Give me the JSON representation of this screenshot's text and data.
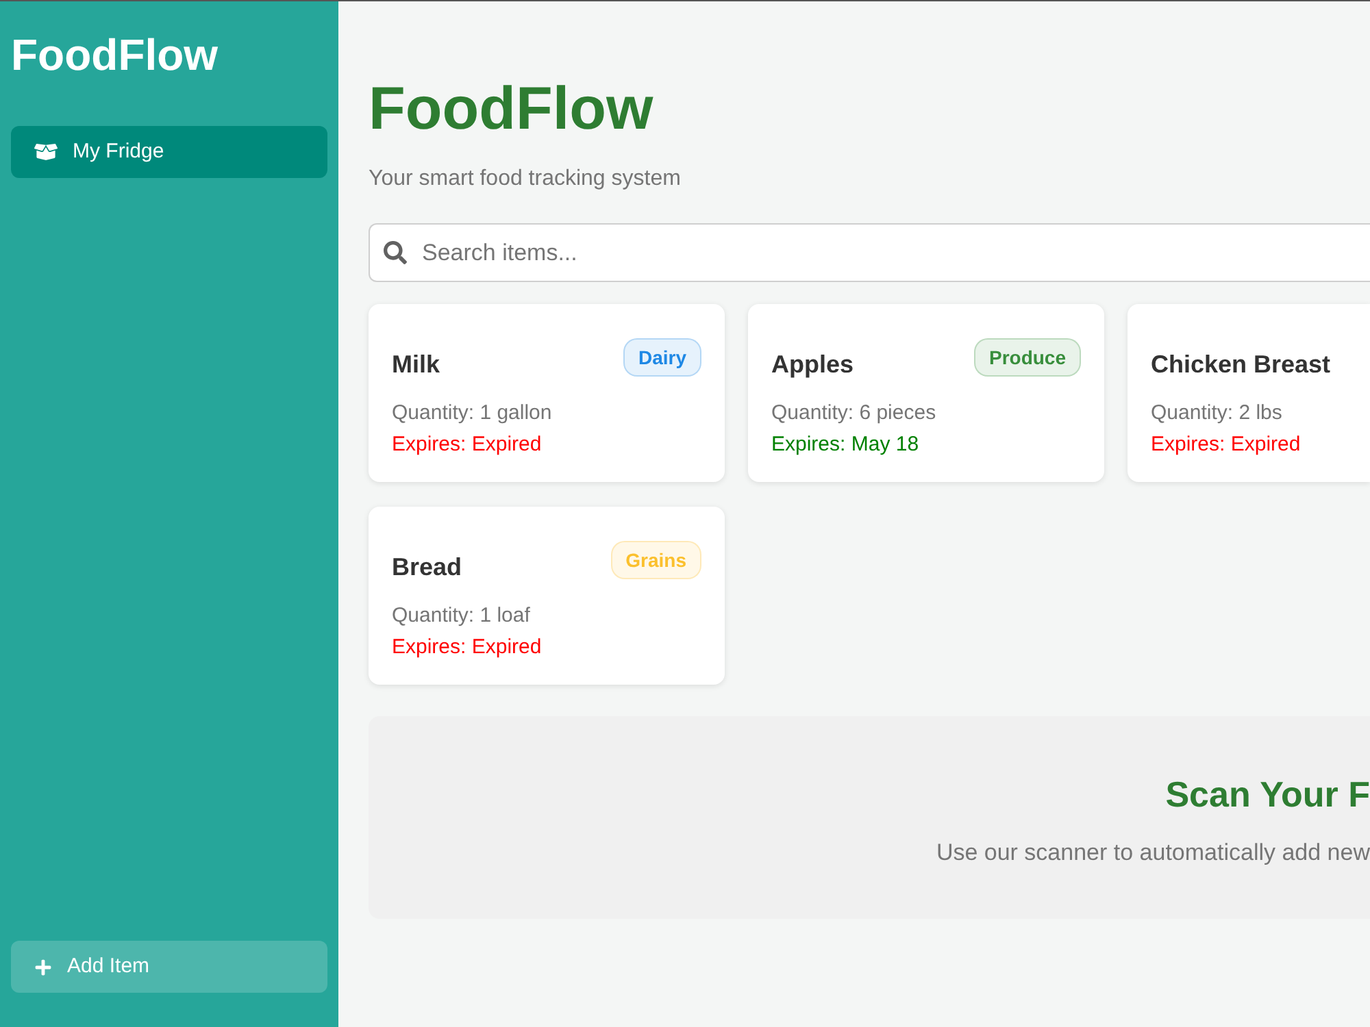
{
  "sidebar": {
    "title": "FoodFlow",
    "nav_items": [
      {
        "label": "My Fridge",
        "selected": true
      }
    ],
    "add_button": "Add Item"
  },
  "header": {
    "title": "FoodFlow",
    "subtitle": "Your smart food tracking system"
  },
  "search": {
    "placeholder": "Search items..."
  },
  "items": [
    {
      "name": "Milk",
      "category": "Dairy",
      "color": "#1e88e5",
      "quantity": "Quantity: 1 gallon",
      "expires": "Expires: Expired",
      "expired": true
    },
    {
      "name": "Apples",
      "category": "Produce",
      "color": "#388e3c",
      "quantity": "Quantity: 6 pieces",
      "expires": "Expires: May 18",
      "expired": false
    },
    {
      "name": "Chicken Breast",
      "quantity": "Quantity: 2 lbs",
      "expires": "Expires: Expired",
      "expired": true
    },
    {
      "name": "Bread",
      "category": "Grains",
      "color": "#fbc02d",
      "quantity": "Quantity: 1 loaf",
      "expires": "Expires: Expired",
      "expired": true
    }
  ],
  "scan_banner": {
    "title": "Scan Your F",
    "text": "Use our scanner to automatically add new"
  }
}
